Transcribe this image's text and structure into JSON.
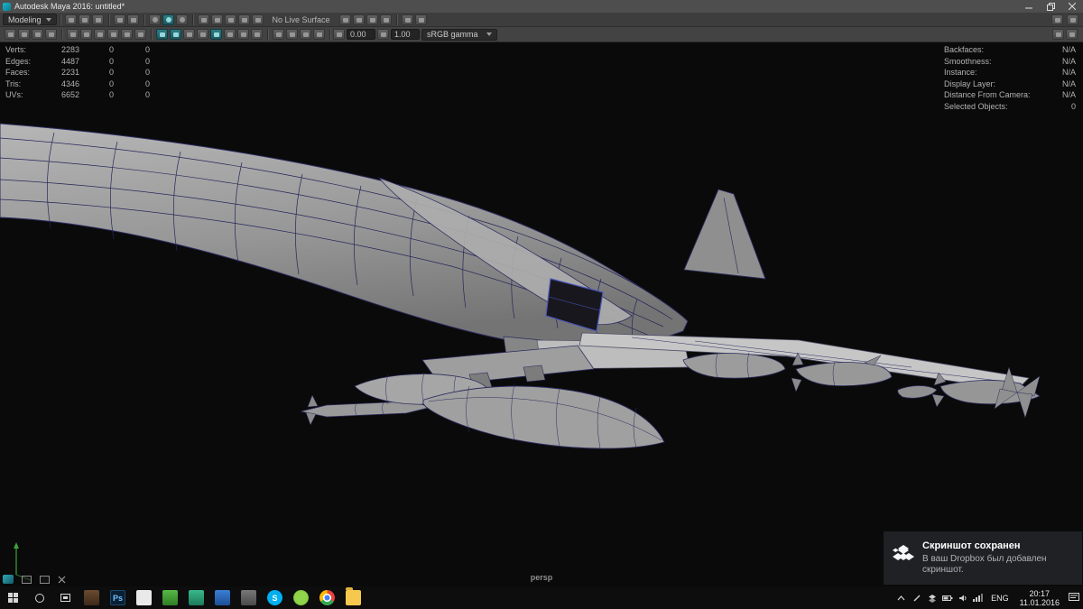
{
  "titlebar": {
    "title": "Autodesk Maya 2016: untitled*"
  },
  "menubar": {
    "menuset": "Modeling",
    "live_surface": "No Live Surface"
  },
  "statusline": {
    "exposure": "0.00",
    "gamma": "1.00",
    "color_space": "sRGB gamma"
  },
  "hud": {
    "left": [
      {
        "label": "Verts:",
        "value": "2283",
        "a": "0",
        "b": "0"
      },
      {
        "label": "Edges:",
        "value": "4487",
        "a": "0",
        "b": "0"
      },
      {
        "label": "Faces:",
        "value": "2231",
        "a": "0",
        "b": "0"
      },
      {
        "label": "Tris:",
        "value": "4346",
        "a": "0",
        "b": "0"
      },
      {
        "label": "UVs:",
        "value": "6652",
        "a": "0",
        "b": "0"
      }
    ],
    "right": [
      {
        "label": "Backfaces:",
        "value": "N/A"
      },
      {
        "label": "Smoothness:",
        "value": "N/A"
      },
      {
        "label": "Instance:",
        "value": "N/A"
      },
      {
        "label": "Display Layer:",
        "value": "N/A"
      },
      {
        "label": "Distance From Camera:",
        "value": "N/A"
      },
      {
        "label": "Selected Objects:",
        "value": "0"
      }
    ]
  },
  "viewport": {
    "camera": "persp"
  },
  "notification": {
    "title": "Скриншот сохранен",
    "body": "В ваш Dropbox был добавлен скриншот."
  },
  "taskbar": {
    "language": "ENG",
    "time": "20:17",
    "date": "11.01.2016",
    "photoshop_label": "Ps",
    "skype_label": "S"
  },
  "colors": {
    "viewport_bg": "#0a0a0a",
    "model_gray": "#9a9a9a",
    "wireframe_blue": "#2c2c62",
    "taskbar_bg": "#0d0d0d",
    "notification_bg": "#1f2125",
    "maya_accent_teal": "#1c565d"
  }
}
